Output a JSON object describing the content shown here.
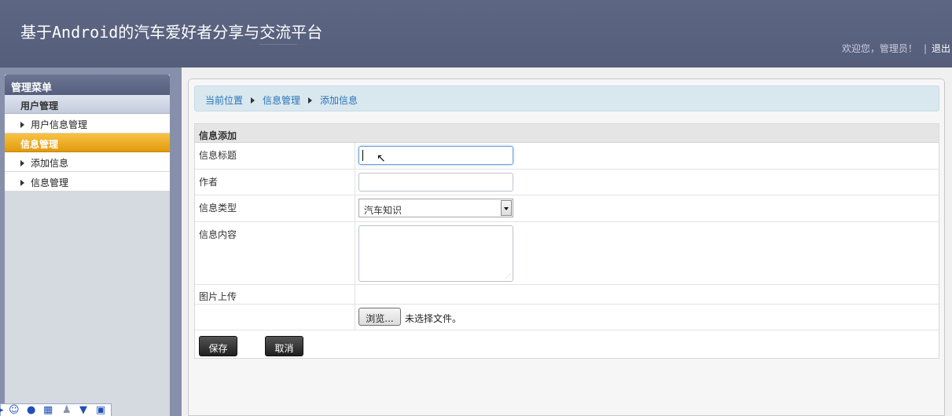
{
  "header": {
    "title": "基于Android的汽车爱好者分享与交流平台",
    "welcome": "欢迎您，管理员！",
    "separator": "|",
    "logout": "退出"
  },
  "sidebar": {
    "title": "管理菜单",
    "groups": [
      {
        "label": "用户管理",
        "items": [
          {
            "label": "用户信息管理"
          }
        ]
      },
      {
        "label": "信息管理",
        "items": [
          {
            "label": "添加信息"
          },
          {
            "label": "信息管理"
          }
        ]
      }
    ]
  },
  "breadcrumb": {
    "items": [
      "当前位置",
      "信息管理",
      "添加信息"
    ]
  },
  "form": {
    "title": "信息添加",
    "fields": {
      "title_label": "信息标题",
      "author_label": "作者",
      "type_label": "信息类型",
      "type_value": "汽车知识",
      "content_label": "信息内容",
      "image_label": "图片上传",
      "browse_label": "浏览...",
      "no_file_text": "未选择文件。"
    },
    "save_label": "保存",
    "cancel_label": "取消"
  },
  "ime_toolbar": {
    "icons": [
      "smiley-icon",
      "microphone-icon",
      "keyboard-icon",
      "user-icon",
      "shirt-icon",
      "grid-icon"
    ]
  },
  "colors": {
    "header_bg": "#5a6380",
    "active_menu": "#f0ad22",
    "breadcrumb_link": "#2a75b7"
  }
}
